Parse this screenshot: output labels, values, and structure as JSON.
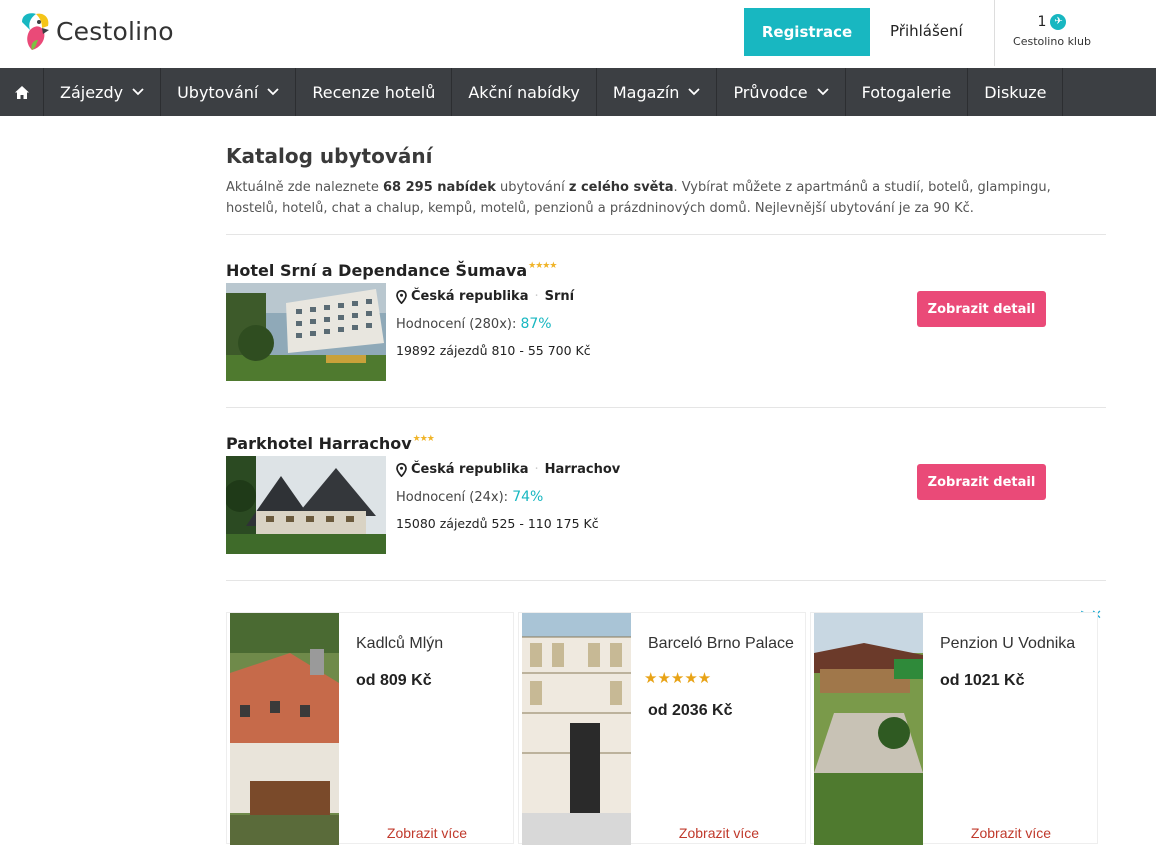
{
  "header": {
    "logo_text": "Cestolino",
    "register_label": "Registrace",
    "login_label": "Přihlášení",
    "club_count": "1",
    "club_label": "Cestolino klub"
  },
  "nav": {
    "items": [
      {
        "label": "Zájezdy",
        "dropdown": true
      },
      {
        "label": "Ubytování",
        "dropdown": true
      },
      {
        "label": "Recenze hotelů",
        "dropdown": false
      },
      {
        "label": "Akční nabídky",
        "dropdown": false
      },
      {
        "label": "Magazín",
        "dropdown": true
      },
      {
        "label": "Průvodce",
        "dropdown": true
      },
      {
        "label": "Fotogalerie",
        "dropdown": false
      },
      {
        "label": "Diskuze",
        "dropdown": false
      }
    ]
  },
  "main": {
    "title": "Katalog ubytování",
    "intro": {
      "p1": "Aktuálně zde naleznete ",
      "count": "68 295 nabídek",
      "p2": " ubytování ",
      "scope": "z celého světa",
      "p3": ". Vybírat můžete z apartmánů a studií, botelů, glampingu, hostelů, hotelů, chat a chalup, kempů, motelů, penzionů a prázdninových domů. Nejlevnější ubytování je za 90 Kč."
    },
    "hotels": [
      {
        "name": "Hotel Srní a Dependance Šumava",
        "stars": "★★★★",
        "country": "Česká republika",
        "city": "Srní",
        "rating_label": "Hodnocení (280x): ",
        "rating_value": "87%",
        "price_line": "19892 zájezdů 810 - 55 700 Kč",
        "button": "Zobrazit detail"
      },
      {
        "name": "Parkhotel Harrachov",
        "stars": "★★★",
        "country": "Česká republika",
        "city": "Harrachov",
        "rating_label": "Hodnocení (24x): ",
        "rating_value": "74%",
        "price_line": "15080 zájezdů 525 - 110 175 Kč",
        "button": "Zobrazit detail"
      }
    ]
  },
  "ads": {
    "choices_icon": "▷✕",
    "items": [
      {
        "title": "Kadlců Mlýn",
        "stars": "",
        "price": "od 809 Kč",
        "more": "Zobrazit více"
      },
      {
        "title": "Barceló Brno Palace",
        "stars": "★★★★★",
        "price": "od 2036 Kč",
        "more": "Zobrazit více"
      },
      {
        "title": "Penzion U Vodnika",
        "stars": "",
        "price": "od 1021 Kč",
        "more": "Zobrazit více"
      }
    ]
  },
  "colors": {
    "accent": "#18b7c1",
    "nav_bg": "#3c3f43",
    "detail_button": "#ea4a78",
    "ad_link": "#c0392b"
  }
}
